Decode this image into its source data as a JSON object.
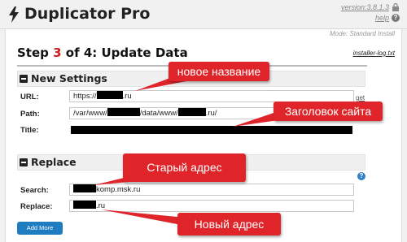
{
  "header": {
    "app_title": "Duplicator Pro",
    "version": "version:3.8.1.3",
    "help": "help",
    "mode": "Mode: Standard Install"
  },
  "step": {
    "prefix": "Step ",
    "number": "3",
    "suffix": " of 4: Update Data",
    "log_link": "installer-log.txt"
  },
  "new_settings": {
    "title": "New Settings",
    "url": {
      "label": "URL:",
      "prefix": "https://",
      "suffix": ".ru",
      "get_link": "get"
    },
    "path": {
      "label": "Path:",
      "p1": "/var/www/",
      "p2": "/data/www/",
      "p3": ".ru/"
    },
    "title_field": {
      "label": "Title:"
    }
  },
  "replace": {
    "title": "Replace",
    "search": {
      "label": "Search:",
      "value_suffix": "komp.msk.ru"
    },
    "replace_field": {
      "label": "Replace:",
      "value_suffix": ".ru"
    },
    "add_more": "Add More"
  },
  "annotations": {
    "new_name": "новое название",
    "site_title": "Заголовок сайта",
    "old_address": "Старый адрес",
    "new_address": "Новый адрес"
  },
  "colors": {
    "accent": "#e0252a",
    "button": "#1e7cc0",
    "step_number": "#cc1f1f"
  }
}
